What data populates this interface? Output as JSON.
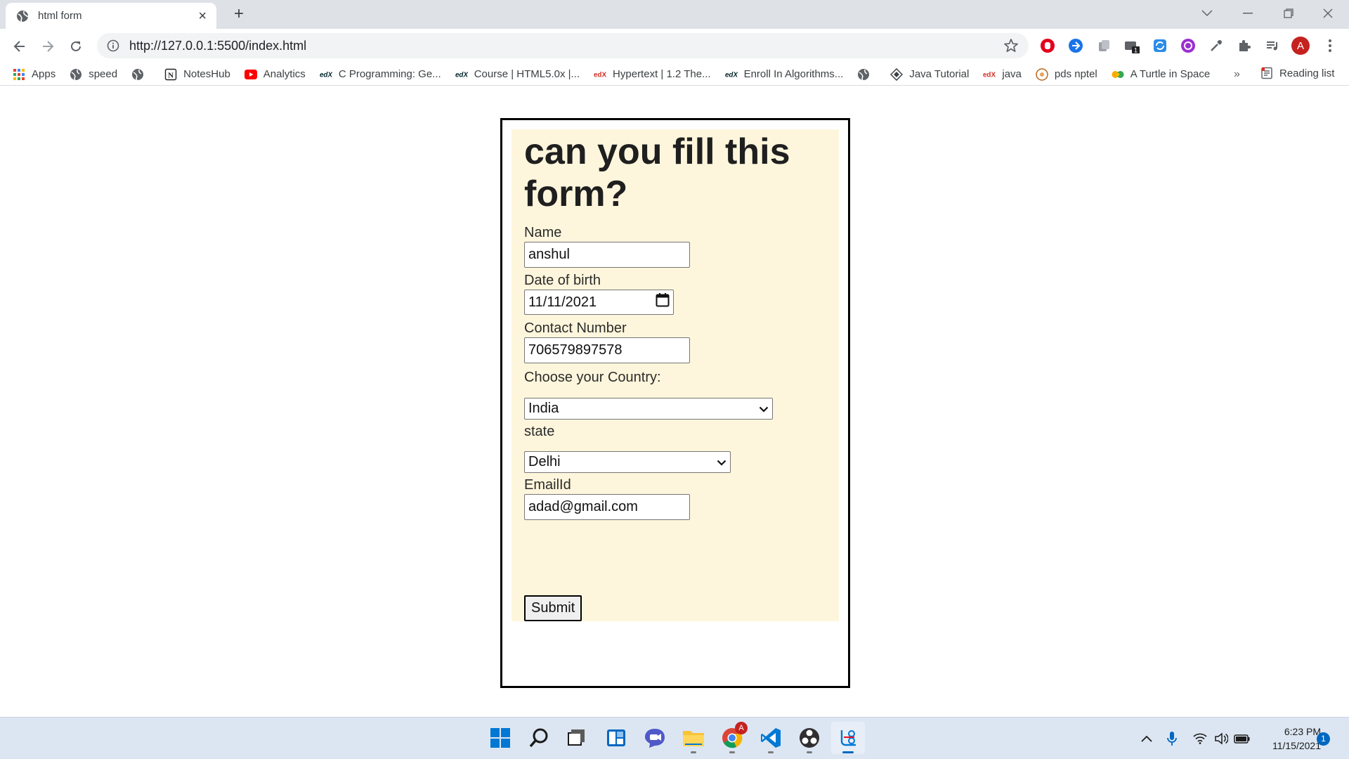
{
  "browser": {
    "tab_title": "html form",
    "new_tab_symbol": "+",
    "url": "http://127.0.0.1:5500/index.html",
    "profile_initial": "A",
    "extension_badge": "1"
  },
  "bookmarks": {
    "items": [
      {
        "label": "Apps",
        "icon": "apps-grid-icon"
      },
      {
        "label": "speed",
        "icon": "globe-icon"
      },
      {
        "label": "",
        "icon": "globe-icon"
      },
      {
        "label": "NotesHub",
        "icon": "notion-icon"
      },
      {
        "label": "Analytics",
        "icon": "youtube-icon"
      },
      {
        "label": "C Programming: Ge...",
        "icon": "edx-icon"
      },
      {
        "label": "Course | HTML5.0x |...",
        "icon": "edx-icon"
      },
      {
        "label": "Hypertext | 1.2 The...",
        "icon": "edx-icon"
      },
      {
        "label": "Enroll In Algorithms...",
        "icon": "edx-icon"
      },
      {
        "label": "",
        "icon": "globe-icon"
      },
      {
        "label": "Java Tutorial",
        "icon": "diamond-icon"
      },
      {
        "label": "java",
        "icon": "edx-icon"
      },
      {
        "label": "pds nptel",
        "icon": "nptel-icon"
      },
      {
        "label": "A Turtle in Space",
        "icon": "colab-icon"
      }
    ],
    "more_symbol": "»",
    "reading_list": "Reading list"
  },
  "form": {
    "title": "can you fill this form?",
    "name_label": "Name",
    "name_value": "anshul",
    "dob_label": "Date of birth",
    "dob_value": "11/11/2021",
    "contact_label": "Contact Number",
    "contact_value": "706579897578",
    "country_label": "Choose your Country:",
    "country_value": "India",
    "state_label": "state",
    "state_value": "Delhi",
    "email_label": "EmailId",
    "email_value": "adad@gmail.com",
    "submit_label": "Submit"
  },
  "taskbar": {
    "time": "6:23 PM",
    "date": "11/15/2021",
    "notification_count": "1",
    "chrome_badge": "A"
  },
  "colors": {
    "form_background": "#fef6dc",
    "taskbar": "#dce6f2",
    "accent": "#0067c0"
  }
}
